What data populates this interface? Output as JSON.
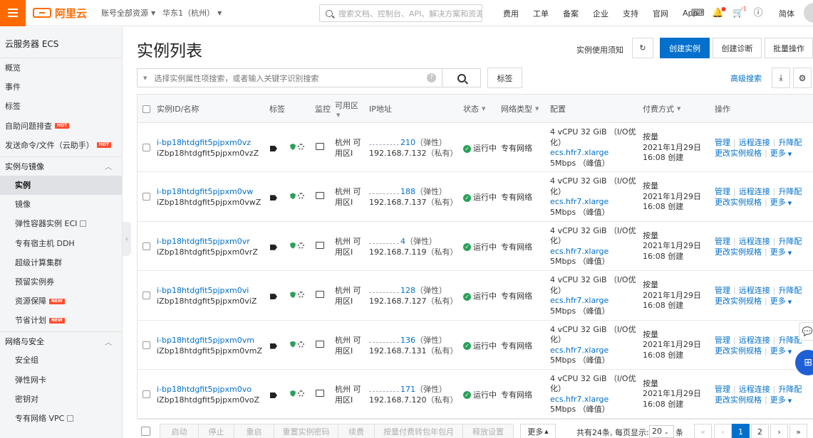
{
  "topbar": {
    "logo_text": "阿里云",
    "account_scope": "账号全部资源",
    "region": "华东1（杭州）",
    "search_placeholder": "搜索文档、控制台、API、解决方案和资源",
    "nav": [
      "费用",
      "工单",
      "备案",
      "企业",
      "支持",
      "官网",
      "App"
    ],
    "notification_count": "1",
    "language": "简体"
  },
  "sidebar": {
    "title": "云服务器 ECS",
    "top_items": [
      {
        "label": "概览"
      },
      {
        "label": "事件"
      },
      {
        "label": "标签"
      },
      {
        "label": "自助问题排查",
        "badge": "HOT"
      },
      {
        "label": "发送命令/文件（云助手）",
        "badge": "HOT"
      }
    ],
    "group1": {
      "label": "实例与镜像",
      "items": [
        {
          "label": "实例"
        },
        {
          "label": "镜像"
        },
        {
          "label": "弹性容器实例 ECI"
        },
        {
          "label": "专有宿主机 DDH"
        },
        {
          "label": "超级计算集群"
        },
        {
          "label": "预留实例券"
        },
        {
          "label": "资源保障",
          "badge": "NEW"
        },
        {
          "label": "节省计划",
          "badge": "NEW"
        }
      ]
    },
    "group2": {
      "label": "网络与安全",
      "items": [
        {
          "label": "安全组"
        },
        {
          "label": "弹性网卡"
        },
        {
          "label": "密钥对"
        },
        {
          "label": "专有网络 VPC"
        }
      ]
    }
  },
  "main": {
    "title": "实例列表",
    "notice_link": "实例使用须知",
    "create_button": "创建实例",
    "diagnose_button": "创建诊断",
    "batch_button": "批量操作",
    "filter_placeholder": "选择实例属性项搜索，或者输入关键字识别搜索",
    "tag_button": "标签",
    "advanced_search": "高级搜索"
  },
  "table": {
    "headers": {
      "id_name": "实例ID/名称",
      "tags": "标签",
      "monitor": "监控",
      "zone": "可用区",
      "ip": "IP地址",
      "status": "状态",
      "network": "网络类型",
      "config": "配置",
      "billing": "付费方式",
      "actions": "操作"
    },
    "rows": [
      {
        "id": "i-bp18htdgfit5pjpxm0vz",
        "name": "iZbp18htdgfit5pjpxm0vzZ",
        "zone1": "杭州 可",
        "zone2": "用区I",
        "public_ip": "210",
        "ip_type1": "（弹性）",
        "private_ip": "192.168.7.132",
        "ip_type2": "（私有）",
        "status": "运行中",
        "network": "专有网络",
        "cfg1": "4 vCPU 32 GiB （I/O优",
        "cfg2": "化）",
        "cfg3": "ecs.hfr7.xlarge",
        "cfg4": "5Mbps （峰值）",
        "bill1": "按量",
        "bill2": "2021年1月29日",
        "bill3": "16:08 创建"
      },
      {
        "id": "i-bp18htdgfit5pjpxm0vw",
        "name": "iZbp18htdgfit5pjpxm0vwZ",
        "zone1": "杭州 可",
        "zone2": "用区I",
        "public_ip": "188",
        "ip_type1": "（弹性）",
        "private_ip": "192.168.7.137",
        "ip_type2": "（私有）",
        "status": "运行中",
        "network": "专有网络",
        "cfg1": "4 vCPU 32 GiB （I/O优",
        "cfg2": "化）",
        "cfg3": "ecs.hfr7.xlarge",
        "cfg4": "5Mbps （峰值）",
        "bill1": "按量",
        "bill2": "2021年1月29日",
        "bill3": "16:08 创建"
      },
      {
        "id": "i-bp18htdgfit5pjpxm0vr",
        "name": "iZbp18htdgfit5pjpxm0vrZ",
        "zone1": "杭州 可",
        "zone2": "用区I",
        "public_ip": "4",
        "ip_type1": "（弹性）",
        "private_ip": "192.168.7.119",
        "ip_type2": "（私有）",
        "status": "运行中",
        "network": "专有网络",
        "cfg1": "4 vCPU 32 GiB （I/O优",
        "cfg2": "化）",
        "cfg3": "ecs.hfr7.xlarge",
        "cfg4": "5Mbps （峰值）",
        "bill1": "按量",
        "bill2": "2021年1月29日",
        "bill3": "16:08 创建"
      },
      {
        "id": "i-bp18htdgfit5pjpxm0vi",
        "name": "iZbp18htdgfit5pjpxm0viZ",
        "zone1": "杭州 可",
        "zone2": "用区I",
        "public_ip": "128",
        "ip_type1": "（弹性）",
        "private_ip": "192.168.7.127",
        "ip_type2": "（私有）",
        "status": "运行中",
        "network": "专有网络",
        "cfg1": "4 vCPU 32 GiB （I/O优",
        "cfg2": "化）",
        "cfg3": "ecs.hfr7.xlarge",
        "cfg4": "5Mbps （峰值）",
        "bill1": "按量",
        "bill2": "2021年1月29日",
        "bill3": "16:08 创建"
      },
      {
        "id": "i-bp18htdgfit5pjpxm0vm",
        "name": "iZbp18htdgfit5pjpxm0vmZ",
        "zone1": "杭州 可",
        "zone2": "用区I",
        "public_ip": "136",
        "ip_type1": "（弹性）",
        "private_ip": "192.168.7.131",
        "ip_type2": "（私有）",
        "status": "运行中",
        "network": "专有网络",
        "cfg1": "4 vCPU 32 GiB （I/O优",
        "cfg2": "化）",
        "cfg3": "ecs.hfr7.xlarge",
        "cfg4": "5Mbps （峰值）",
        "bill1": "按量",
        "bill2": "2021年1月29日",
        "bill3": "16:08 创建"
      },
      {
        "id": "i-bp18htdgfit5pjpxm0vo",
        "name": "iZbp18htdgfit5pjpxm0voZ",
        "zone1": "杭州 可",
        "zone2": "用区I",
        "public_ip": "171",
        "ip_type1": "（弹性）",
        "private_ip": "192.168.7.120",
        "ip_type2": "（私有）",
        "status": "运行中",
        "network": "专有网络",
        "cfg1": "4 vCPU 32 GiB （I/O优",
        "cfg2": "化）",
        "cfg3": "ecs.hfr7.xlarge",
        "cfg4": "5Mbps （峰值）",
        "bill1": "按量",
        "bill2": "2021年1月29日",
        "bill3": "16:08 创建"
      }
    ],
    "actions": {
      "manage": "管理",
      "remote": "远程连接",
      "upgrade": "升降配",
      "change_spec": "更改实例规格",
      "more": "更多"
    }
  },
  "footer": {
    "buttons": [
      "启动",
      "停止",
      "重启",
      "重置实例密码",
      "续费",
      "按量付费转包年包月",
      "释放设置"
    ],
    "more": "更多",
    "total_text": "共有24条, 每页显示:",
    "page_size": "20",
    "unit": "条",
    "first": "«",
    "prev": "‹",
    "pages": [
      "1",
      "2"
    ],
    "next": "›",
    "last": "»"
  },
  "colors": {
    "brand": "#ff6a00",
    "primary": "#0070cc",
    "success": "#2aa05a"
  }
}
